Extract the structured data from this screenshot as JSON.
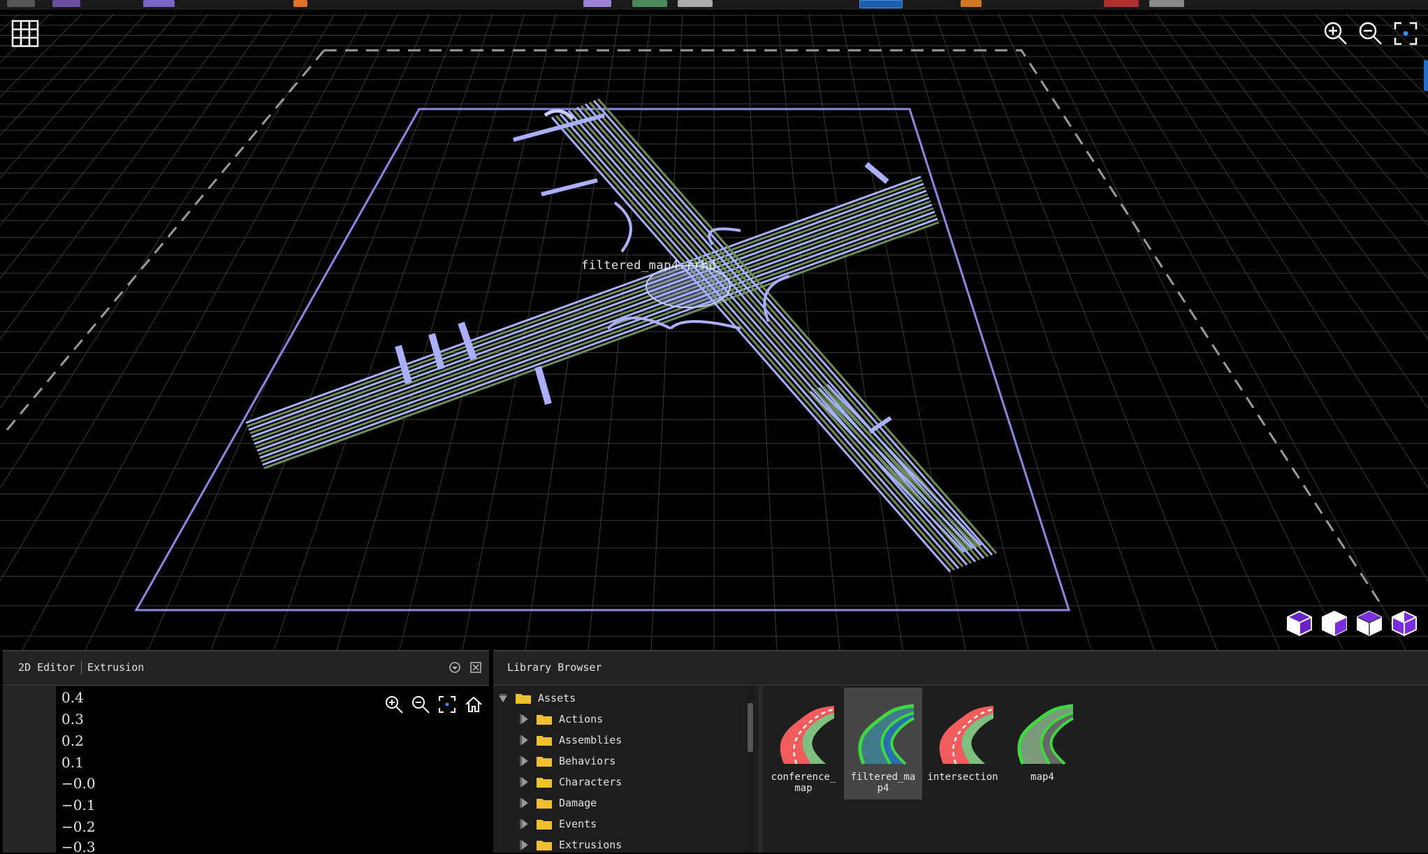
{
  "viewport": {
    "map_label": "filtered_map4.rrhd",
    "controls": {
      "grid_toggle": "grid-icon",
      "zoom_in": "zoom-in-icon",
      "zoom_out": "zoom-out-icon",
      "fit": "fit-view-icon"
    },
    "view_cubes": [
      "view-cube-front-icon",
      "view-cube-side-icon",
      "view-cube-top-icon",
      "view-cube-iso-icon"
    ],
    "colors": {
      "background": "#000000",
      "grid": "#3a3a3a",
      "road_wire": "#aab0ff",
      "lane_fill": "#6b8f5a",
      "bounds": "#8c87e0",
      "dashed_bounds": "#9a9a9a"
    }
  },
  "editor_panel": {
    "tabs": [
      "2D Editor",
      "Extrusion"
    ],
    "y_ticks": [
      "0.4",
      "0.3",
      "0.2",
      "0.1",
      "−0.0",
      "−0.1",
      "−0.2",
      "−0.3"
    ],
    "controls": [
      "zoom-in-icon",
      "zoom-out-icon",
      "fit-view-icon",
      "home-icon"
    ]
  },
  "library_panel": {
    "title": "Library Browser",
    "tree": {
      "root": "Assets",
      "children": [
        "Actions",
        "Assemblies",
        "Behaviors",
        "Characters",
        "Damage",
        "Events",
        "Extrusions"
      ]
    },
    "assets": [
      {
        "name": "conference_\nmap",
        "style": "red",
        "selected": false
      },
      {
        "name": "filtered_ma\np4",
        "style": "green",
        "selected": true
      },
      {
        "name": "intersection",
        "style": "red",
        "selected": false
      },
      {
        "name": "map4",
        "style": "green",
        "selected": false
      }
    ]
  }
}
